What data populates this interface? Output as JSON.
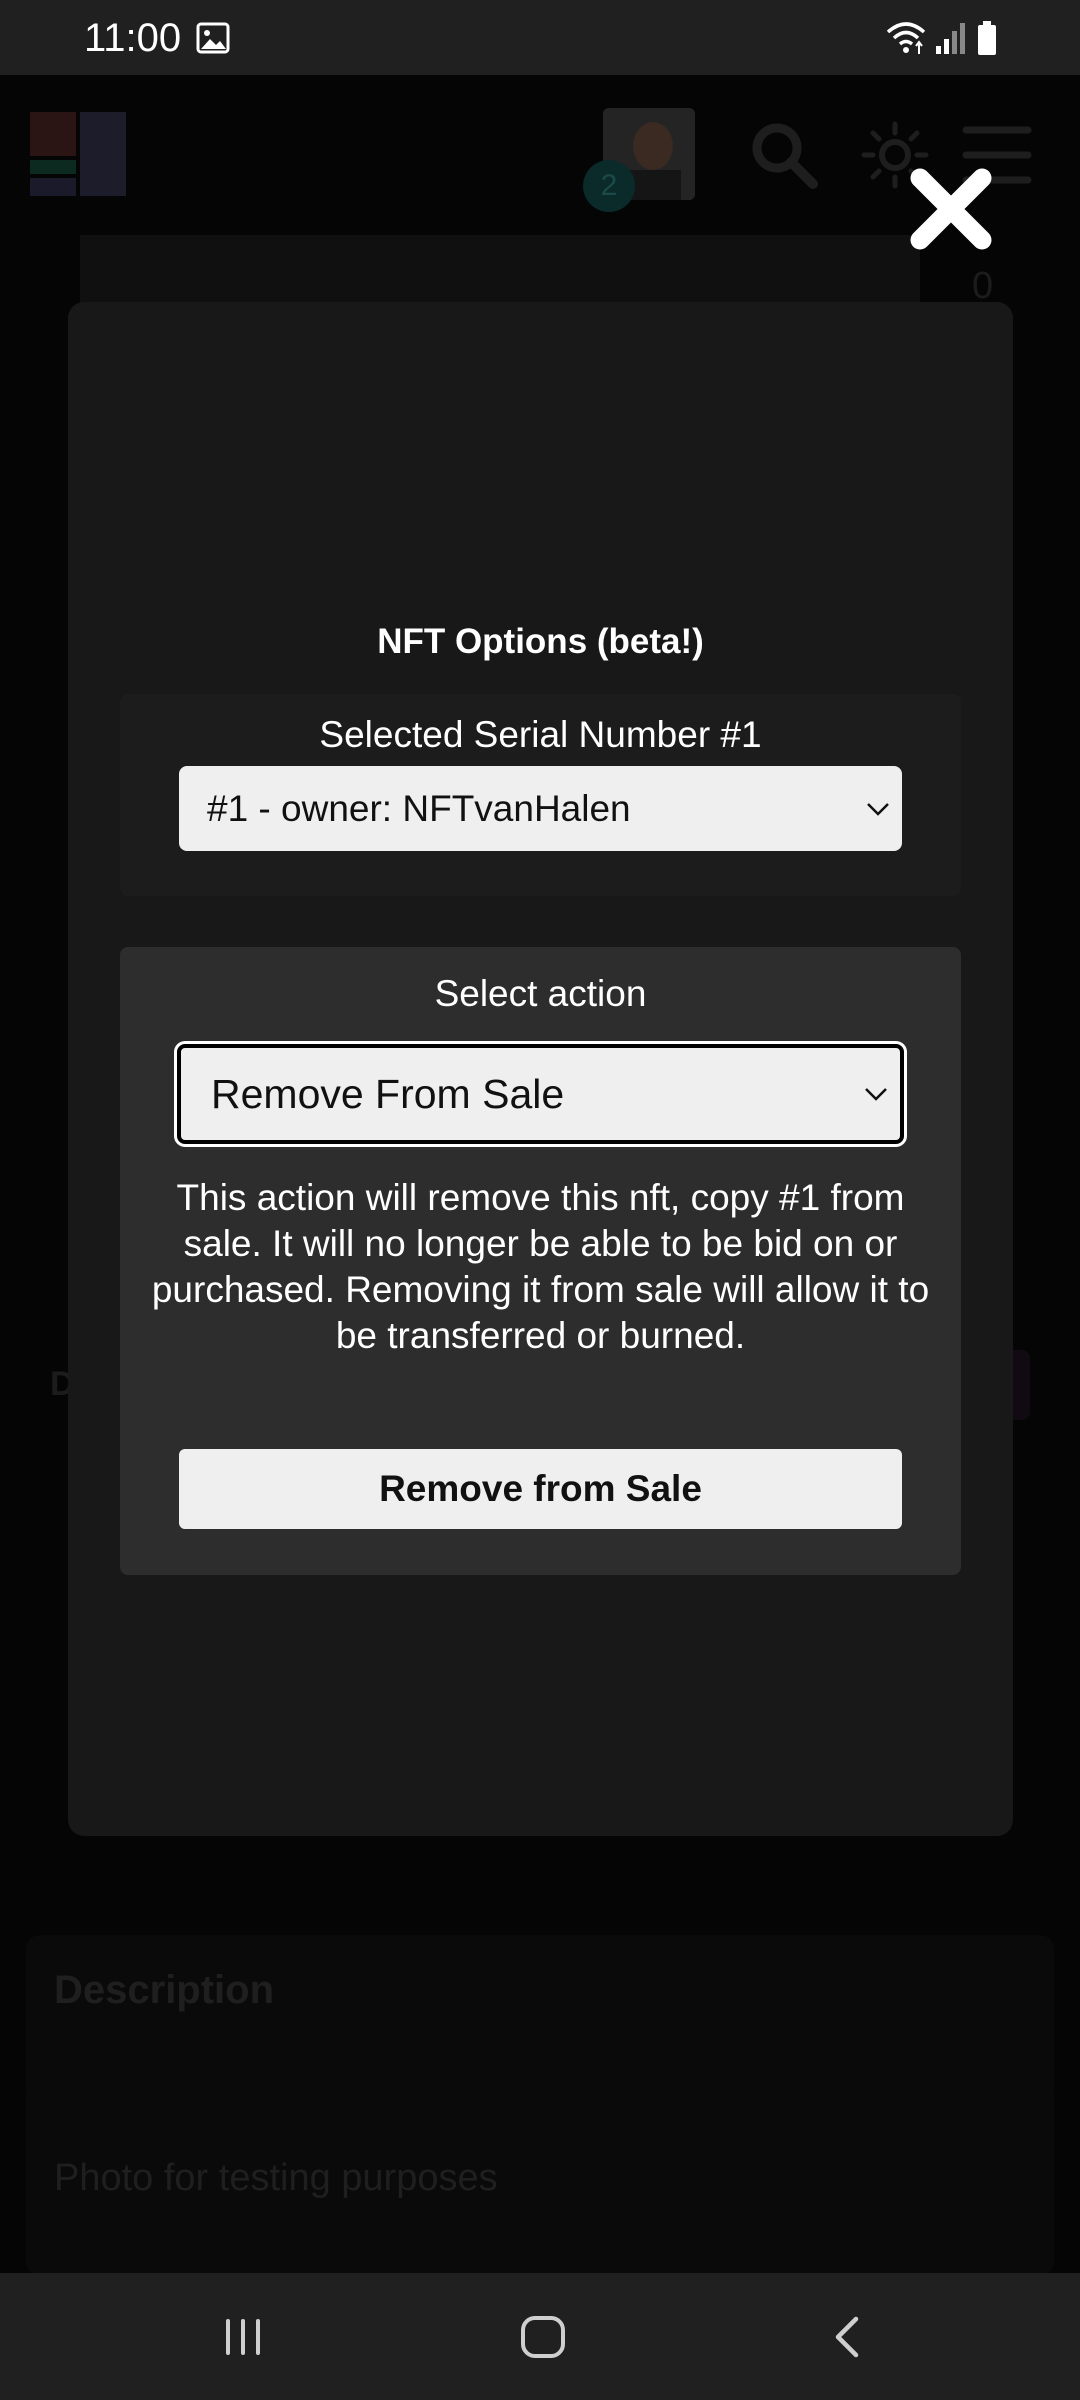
{
  "status_bar": {
    "time": "11:00",
    "icons": [
      "gallery-icon",
      "wifi-icon",
      "signal-icon",
      "battery-icon"
    ]
  },
  "background": {
    "avatar_badge": "2",
    "counter": "0",
    "side_letter": "D",
    "description_title": "Description",
    "photo_text": "Photo for testing purposes"
  },
  "modal": {
    "title": "NFT Options (beta!)",
    "serial_label": "Selected Serial Number #1",
    "serial_select_value": "#1 - owner: NFTvanHalen",
    "action_label": "Select action",
    "action_select_value": "Remove From Sale",
    "action_description": "This action will remove this nft, copy #1 from sale. It will no longer be able to be bid on or purchased. Removing it from sale will allow it to be transferred or burned.",
    "action_button": "Remove from Sale"
  },
  "colors": {
    "modal_bg": "#181818",
    "action_panel_bg": "#2d2d2d",
    "control_bg": "#efefef"
  }
}
